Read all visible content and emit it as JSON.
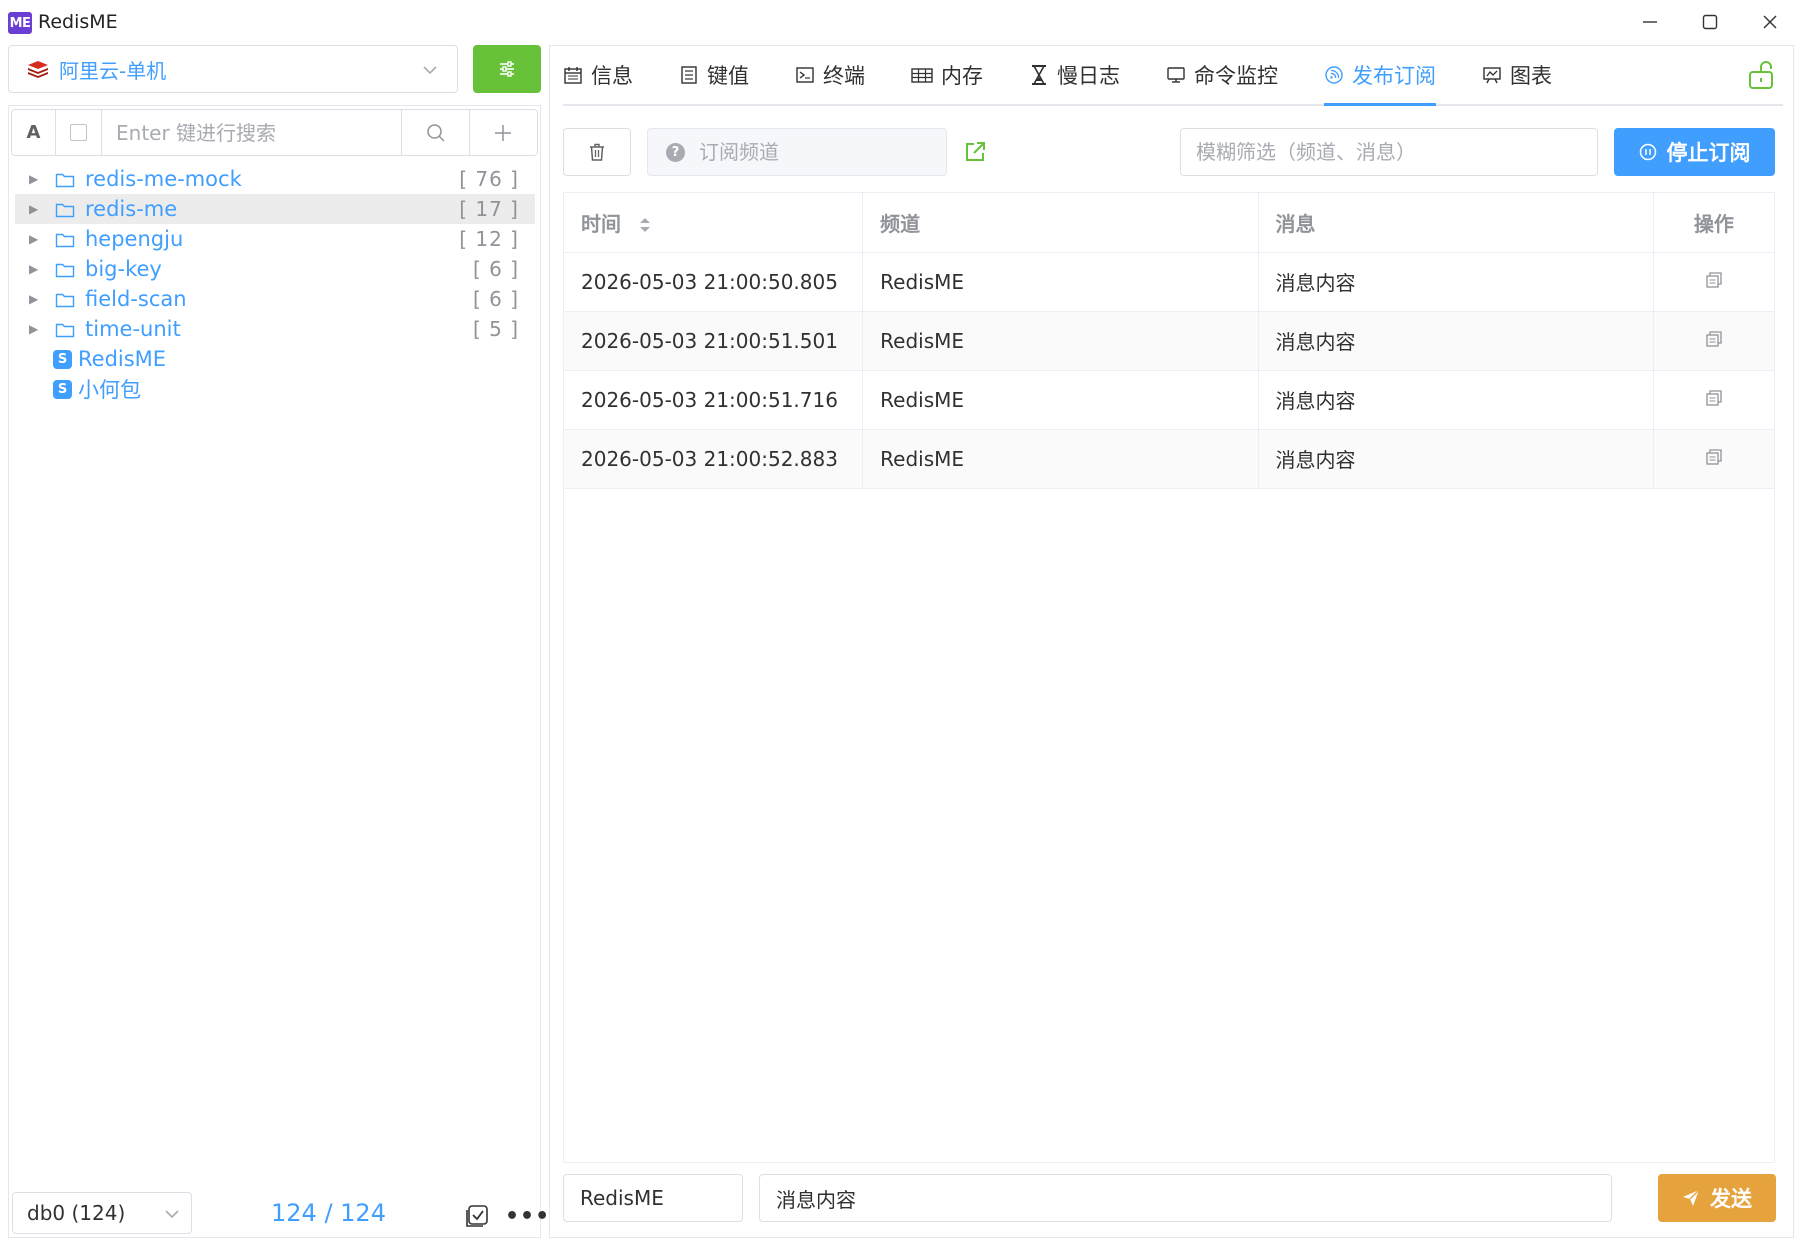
{
  "app": {
    "logo_text": "ME",
    "title": "RedisME"
  },
  "connection": {
    "selected": "阿里云-单机"
  },
  "key_search": {
    "mode_label": "A",
    "placeholder": "Enter 键进行搜索"
  },
  "tree": {
    "folders": [
      {
        "name": "redis-me-mock",
        "count": "[ 76 ]",
        "active": false
      },
      {
        "name": "redis-me",
        "count": "[ 17 ]",
        "active": true
      },
      {
        "name": "hepengju",
        "count": "[ 12 ]",
        "active": false
      },
      {
        "name": "big-key",
        "count": "[ 6 ]",
        "active": false
      },
      {
        "name": "field-scan",
        "count": "[ 6 ]",
        "active": false
      },
      {
        "name": "time-unit",
        "count": "[ 5 ]",
        "active": false
      }
    ],
    "keys": [
      {
        "type": "S",
        "name": "RedisME"
      },
      {
        "type": "S",
        "name": "小何包"
      }
    ]
  },
  "footer": {
    "db_select": "db0 (124)",
    "key_count": "124 / 124"
  },
  "tabs": [
    {
      "icon": "calendar-icon",
      "label": "信息"
    },
    {
      "icon": "document-icon",
      "label": "键值"
    },
    {
      "icon": "terminal-icon",
      "label": "终端"
    },
    {
      "icon": "grid-icon",
      "label": "内存"
    },
    {
      "icon": "hourglass-icon",
      "label": "慢日志"
    },
    {
      "icon": "monitor-icon",
      "label": "命令监控"
    },
    {
      "icon": "broadcast-icon",
      "label": "发布订阅"
    },
    {
      "icon": "chart-icon",
      "label": "图表"
    }
  ],
  "active_tab": 6,
  "pubsub": {
    "channel_placeholder": "订阅频道",
    "filter_placeholder": "模糊筛选（频道、消息）",
    "stop_label": "停止订阅",
    "columns": [
      "时间",
      "频道",
      "消息",
      "操作"
    ],
    "rows": [
      {
        "time": "2026-05-03 21:00:50.805",
        "channel": "RedisME",
        "message": "消息内容"
      },
      {
        "time": "2026-05-03 21:00:51.501",
        "channel": "RedisME",
        "message": "消息内容"
      },
      {
        "time": "2026-05-03 21:00:51.716",
        "channel": "RedisME",
        "message": "消息内容"
      },
      {
        "time": "2026-05-03 21:00:52.883",
        "channel": "RedisME",
        "message": "消息内容"
      }
    ],
    "publish_channel": "RedisME",
    "publish_message": "消息内容",
    "send_label": "发送"
  },
  "colors": {
    "primary": "#409eff",
    "success": "#67c23a",
    "warning": "#e6a23c",
    "logo": "#6b3fd4"
  }
}
